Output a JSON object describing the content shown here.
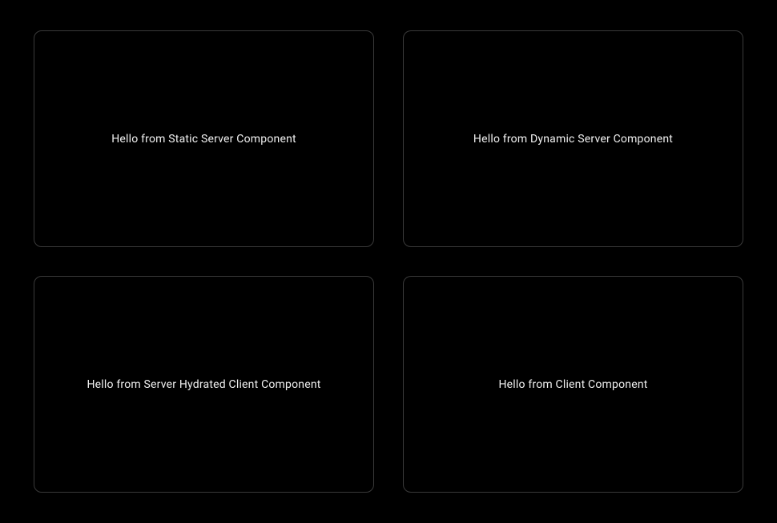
{
  "cards": {
    "topLeft": {
      "text": "Hello from Static Server Component"
    },
    "topRight": {
      "text": "Hello from Dynamic Server Component"
    },
    "bottomLeft": {
      "text": "Hello from Server Hydrated Client Component"
    },
    "bottomRight": {
      "text": "Hello from Client Component"
    }
  }
}
